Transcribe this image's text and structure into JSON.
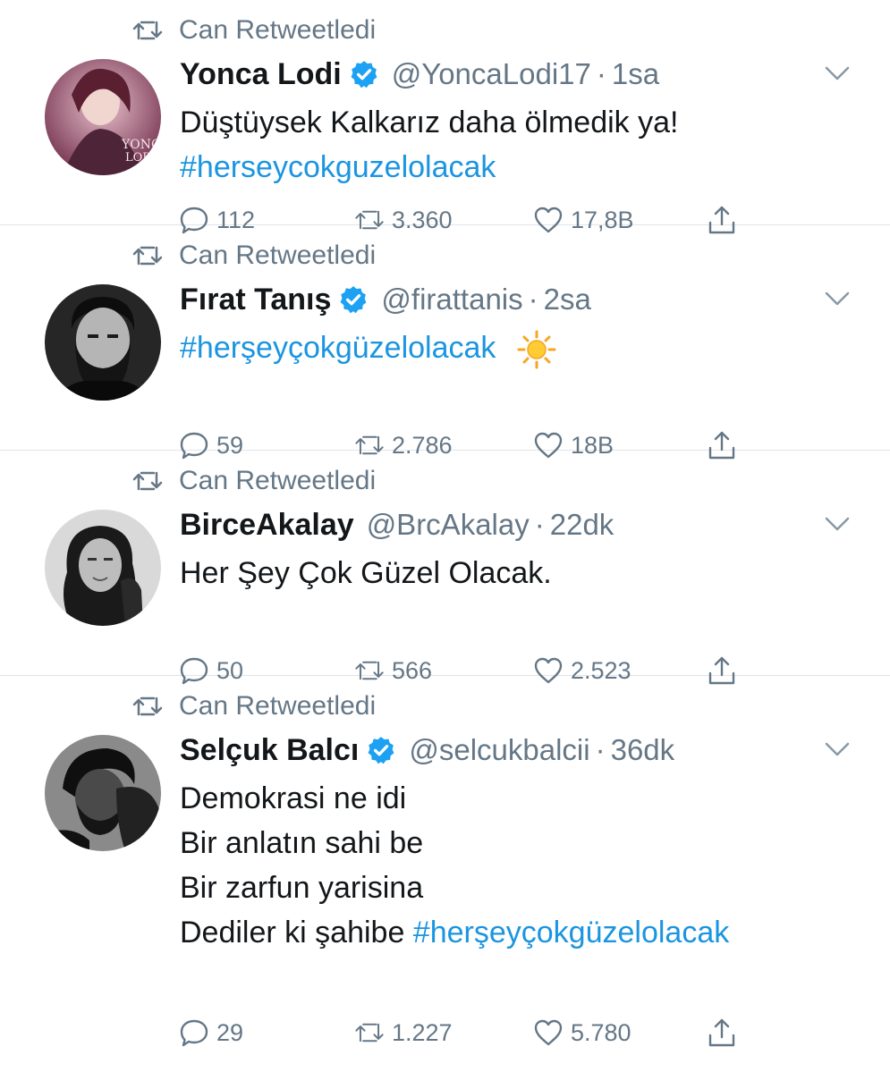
{
  "tweets": [
    {
      "retweeted_by": "Can Retweetledi",
      "name": "Yonca Lodi",
      "verified": true,
      "handle": "@YoncaLodi17",
      "time": "1sa",
      "lines": [
        {
          "text": "Düştüysek Kalkarız daha ölmedik ya!",
          "hashtag": ""
        },
        {
          "text": "",
          "hashtag": "#herseycokguzelolacak"
        }
      ],
      "counts": {
        "replies": "112",
        "retweets": "3.360",
        "likes": "17,8B"
      }
    },
    {
      "retweeted_by": "Can Retweetledi",
      "name": "Fırat Tanış",
      "verified": true,
      "handle": "@firattanis",
      "time": "2sa",
      "lines": [
        {
          "text": "",
          "hashtag": "#herşeyçokgüzelolacak",
          "emoji": "sun-emoji"
        }
      ],
      "counts": {
        "replies": "59",
        "retweets": "2.786",
        "likes": "18B"
      }
    },
    {
      "retweeted_by": "Can Retweetledi",
      "name": "BirceAkalay",
      "verified": false,
      "handle": "@BrcAkalay",
      "time": "22dk",
      "lines": [
        {
          "text": "Her Şey Çok Güzel Olacak.",
          "hashtag": ""
        }
      ],
      "counts": {
        "replies": "50",
        "retweets": "566",
        "likes": "2.523"
      }
    },
    {
      "retweeted_by": "Can Retweetledi",
      "name": "Selçuk Balcı",
      "verified": true,
      "handle": "@selcukbalcii",
      "time": "36dk",
      "lines": [
        {
          "text": "Demokrasi ne idi",
          "hashtag": ""
        },
        {
          "text": "Bir anlatın sahi be",
          "hashtag": ""
        },
        {
          "text": "Bir zarfun yarisina",
          "hashtag": ""
        },
        {
          "text": "Dediler ki şahibe ",
          "hashtag": "#herşeyçokgüzelolacak"
        }
      ],
      "counts": {
        "replies": "29",
        "retweets": "1.227",
        "likes": "5.780"
      }
    }
  ],
  "colors": {
    "link": "#1b95e0",
    "muted": "#657786",
    "verified": "#1da1f2"
  },
  "icons": [
    "retweet-icon",
    "verified-icon",
    "chevron-down-icon",
    "reply-icon",
    "like-icon",
    "share-icon",
    "sun-emoji"
  ]
}
